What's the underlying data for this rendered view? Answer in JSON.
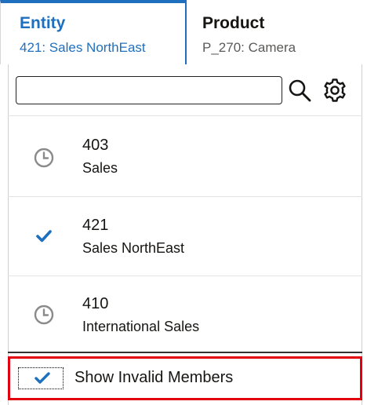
{
  "tabs": [
    {
      "title": "Entity",
      "subtitle": "421: Sales NorthEast",
      "active": true
    },
    {
      "title": "Product",
      "subtitle": "P_270: Camera",
      "active": false
    }
  ],
  "search": {
    "value": "",
    "placeholder": ""
  },
  "icons": {
    "search": "search-icon",
    "settings": "gear-icon",
    "recent": "clock-icon",
    "selected": "checkmark-icon"
  },
  "members": [
    {
      "code": "403",
      "name": "Sales",
      "icon": "clock-icon"
    },
    {
      "code": "421",
      "name": "Sales NorthEast",
      "icon": "checkmark-icon"
    },
    {
      "code": "410",
      "name": "International Sales",
      "icon": "clock-icon"
    }
  ],
  "footer": {
    "label": "Show Invalid Members",
    "checked": true
  },
  "colors": {
    "accent": "#1f6fbf",
    "highlight": "#e2000f",
    "icon_gray": "#8a8a8a"
  }
}
